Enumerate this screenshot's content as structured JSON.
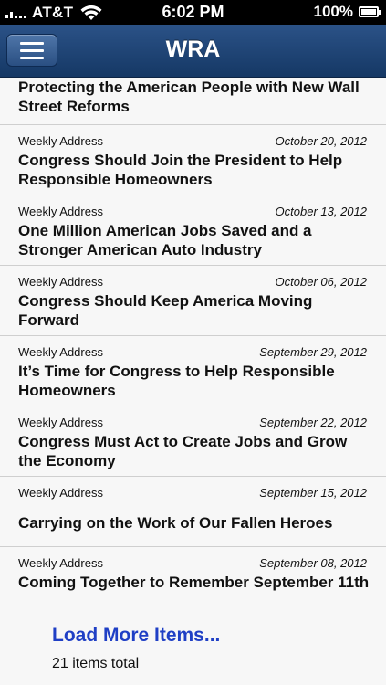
{
  "status_bar": {
    "carrier": "AT&T",
    "time": "6:02 PM",
    "battery": "100%",
    "battery_level": 1.0
  },
  "nav": {
    "title": "WRA",
    "menu_icon": "hamburger-menu-icon"
  },
  "partial_item": {
    "title": "Protecting the American People with New Wall Street Reforms"
  },
  "items": [
    {
      "category": "Weekly Address",
      "date": "October 20, 2012",
      "title": "Congress Should Join the President to Help Responsible Homeowners"
    },
    {
      "category": "Weekly Address",
      "date": "October 13, 2012",
      "title": "One Million American Jobs Saved and a Stronger American Auto Industry"
    },
    {
      "category": "Weekly Address",
      "date": "October 06, 2012",
      "title": "Congress Should Keep America Moving Forward"
    },
    {
      "category": "Weekly Address",
      "date": "September 29, 2012",
      "title": "It’s Time for Congress to Help Responsible Homeowners"
    },
    {
      "category": "Weekly Address",
      "date": "September 22, 2012",
      "title": "Congress Must Act to Create Jobs and Grow the Economy"
    },
    {
      "category": "Weekly Address",
      "date": "September 15, 2012",
      "title": "Carrying on the Work of Our Fallen Heroes"
    },
    {
      "category": "Weekly Address",
      "date": "September 08, 2012",
      "title": "Coming Together to Remember September 11th"
    }
  ],
  "load_more": {
    "label": "Load More Items...",
    "total": "21 items total"
  }
}
